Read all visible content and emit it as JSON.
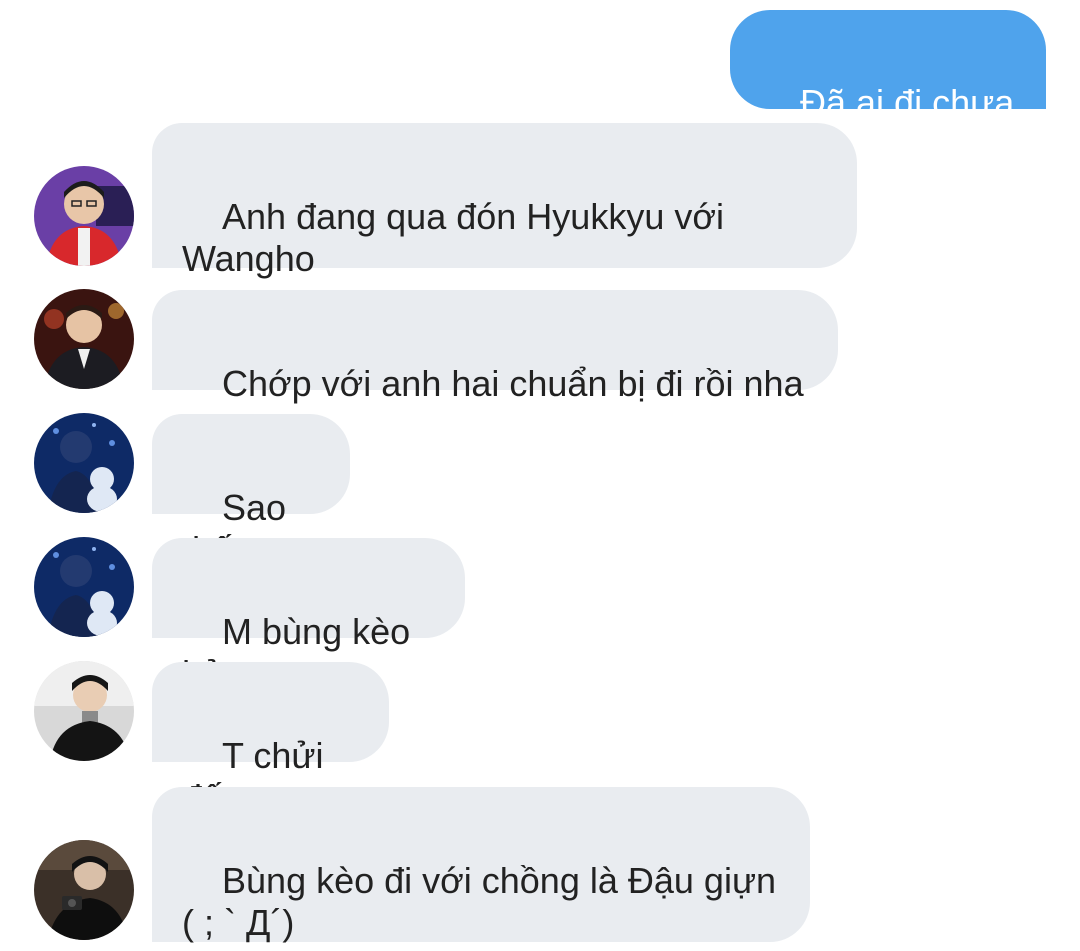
{
  "colors": {
    "outgoing_bubble": "#4fa3ec",
    "incoming_bubble": "#e9ecf0",
    "text": "#222222"
  },
  "messages": [
    {
      "direction": "outgoing",
      "text": "Đã ai đi chưa ạ"
    },
    {
      "direction": "incoming",
      "avatar": "avatar-red-jacket",
      "text": "Anh đang qua đón Hyukkyu với\nWangho"
    },
    {
      "direction": "incoming",
      "avatar": "avatar-dark-suit",
      "text": "Chớp với anh hai chuẩn bị đi rồi nha"
    },
    {
      "direction": "incoming",
      "avatar": "avatar-blue-plush",
      "text": "Sao thế"
    },
    {
      "direction": "incoming",
      "avatar": "avatar-blue-plush",
      "text": "M bùng kèo hả"
    },
    {
      "direction": "incoming",
      "avatar": "avatar-turtleneck",
      "text": "T chửi đấy"
    },
    {
      "direction": "incoming",
      "avatar": "avatar-dark-camera",
      "text": "Bùng kèo đi với chồng là Đậu giựn\n( ; ` Д´)"
    }
  ]
}
